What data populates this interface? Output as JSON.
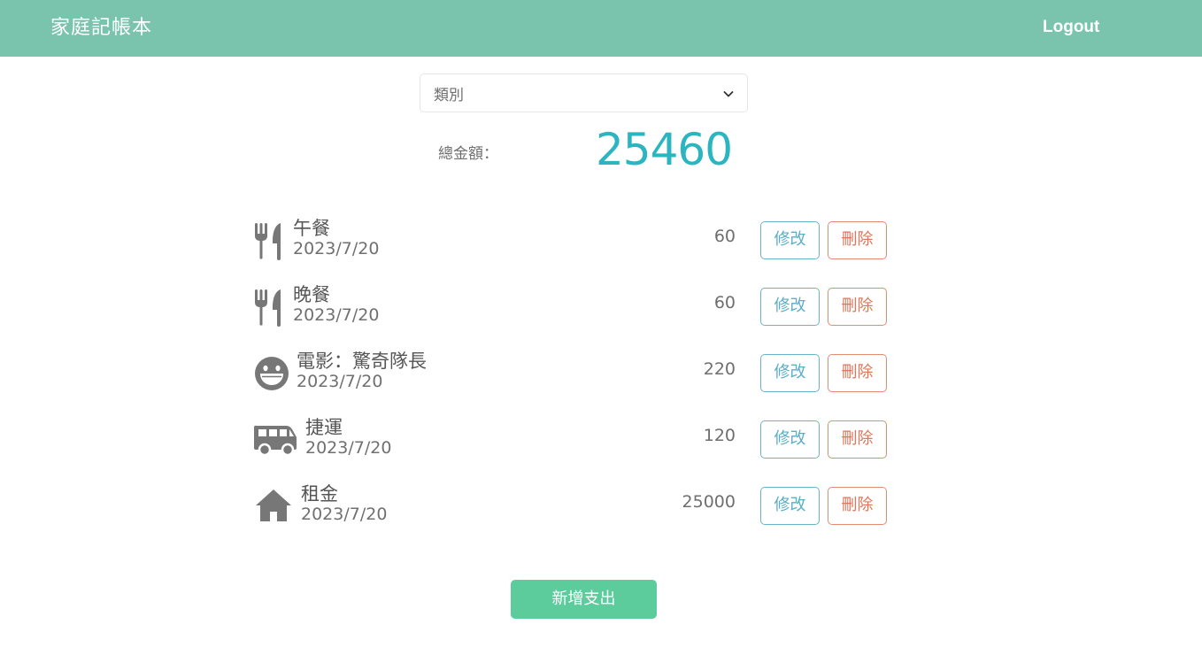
{
  "navbar": {
    "brand": "家庭記帳本",
    "logout_label": "Logout"
  },
  "filter": {
    "category_label": "類別",
    "icon": "chevron-down-icon"
  },
  "summary": {
    "total_label": "總金額：",
    "total_value": "25460"
  },
  "expenses": [
    {
      "icon": "utensils-icon",
      "title": "午餐",
      "date": "2023/7/20",
      "amount": "60",
      "edit_label": "修改",
      "delete_label": "刪除"
    },
    {
      "icon": "utensils-icon",
      "title": "晚餐",
      "date": "2023/7/20",
      "amount": "60",
      "edit_label": "修改",
      "delete_label": "刪除"
    },
    {
      "icon": "grin-icon",
      "title": "電影：驚奇隊長",
      "date": "2023/7/20",
      "amount": "220",
      "edit_label": "修改",
      "delete_label": "刪除"
    },
    {
      "icon": "shuttle-van-icon",
      "title": "捷運",
      "date": "2023/7/20",
      "amount": "120",
      "edit_label": "修改",
      "delete_label": "刪除"
    },
    {
      "icon": "home-icon",
      "title": "租金",
      "date": "2023/7/20",
      "amount": "25000",
      "edit_label": "修改",
      "delete_label": "刪除"
    }
  ],
  "actions": {
    "add_label": "新增支出"
  },
  "colors": {
    "navbar": "#7ac4ae",
    "total": "#2bb5c1",
    "edit": "#5aaec6",
    "delete": "#e0765a",
    "add": "#5ccc9c",
    "icon": "#777777"
  }
}
